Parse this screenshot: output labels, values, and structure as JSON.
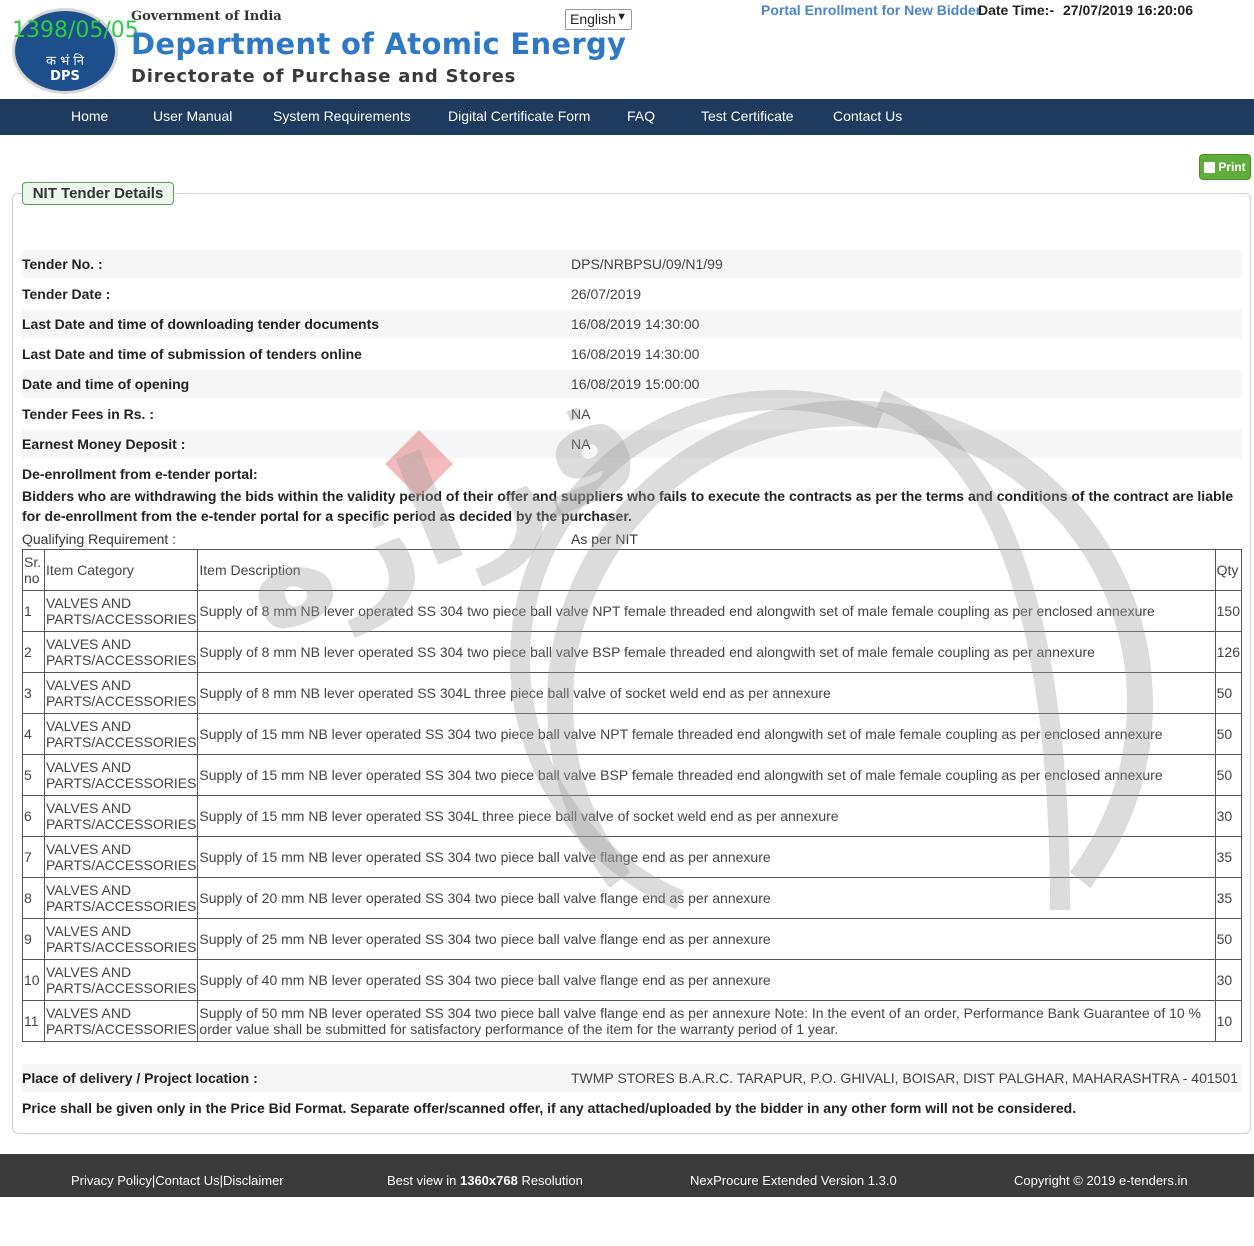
{
  "header": {
    "stamp_text": "1398/05/05",
    "logo_hindi": "क भं नि",
    "logo_abbr": "DPS",
    "gov_label": "Government of India",
    "department": "Department of Atomic Energy",
    "directorate": "Directorate of Purchase and Stores",
    "language": "English",
    "portal_link": "Portal Enrollment for New Bidder",
    "datetime_label": "Date Time:-",
    "datetime_value": "27/07/2019 16:20:06"
  },
  "nav": {
    "items": [
      "Home",
      "User Manual",
      "System Requirements",
      "Digital Certificate Form",
      "FAQ",
      "Test Certificate",
      "Contact Us"
    ]
  },
  "print_label": "Print",
  "section_title": "NIT Tender Details",
  "details": [
    {
      "label": "Tender No. :",
      "value": "DPS/NRBPSU/09/N1/99"
    },
    {
      "label": "Tender Date :",
      "value": "26/07/2019"
    },
    {
      "label": "Last Date and time of downloading tender documents",
      "value": "16/08/2019 14:30:00"
    },
    {
      "label": "Last Date and time of submission of tenders online",
      "value": "16/08/2019 14:30:00"
    },
    {
      "label": "Date and time of opening",
      "value": "16/08/2019 15:00:00"
    },
    {
      "label": "Tender Fees in Rs. :",
      "value": "NA"
    },
    {
      "label": "Earnest Money Deposit :",
      "value": "NA"
    }
  ],
  "deenrollment": {
    "title": "De-enrollment from e-tender portal:",
    "text": "Bidders who are withdrawing the bids within the validity period of their offer and suppliers who fails to execute the contracts as per the terms and conditions of the contract are liable for de-enrollment from the e-tender portal for a specific period as decided by the purchaser."
  },
  "qualifying": {
    "label": "Qualifying Requirement :",
    "value": "As per NIT"
  },
  "items_table": {
    "headers": {
      "sr": "Sr. no",
      "category": "Item Category",
      "description": "Item Description",
      "qty": "Qty"
    },
    "rows": [
      {
        "sr": "1",
        "category": "VALVES AND PARTS/ACCESSORIES",
        "description": "Supply of 8 mm NB lever operated SS 304 two piece ball valve NPT female threaded end alongwith set of male female coupling as per enclosed annexure",
        "qty": "150"
      },
      {
        "sr": "2",
        "category": "VALVES AND PARTS/ACCESSORIES",
        "description": "Supply of 8 mm NB lever operated SS 304 two piece ball valve BSP female threaded end alongwith set of male female coupling as per annexure",
        "qty": "126"
      },
      {
        "sr": "3",
        "category": "VALVES AND PARTS/ACCESSORIES",
        "description": "Supply of 8 mm NB lever operated SS 304L three piece ball valve of socket weld end as per annexure",
        "qty": "50"
      },
      {
        "sr": "4",
        "category": "VALVES AND PARTS/ACCESSORIES",
        "description": "Supply of 15 mm NB lever operated SS 304 two piece ball valve NPT female threaded end alongwith set of male female coupling as per enclosed annexure",
        "qty": "50"
      },
      {
        "sr": "5",
        "category": "VALVES AND PARTS/ACCESSORIES",
        "description": "Supply of 15 mm NB lever operated SS 304 two piece ball valve BSP female threaded end alongwith set of male female coupling as per enclosed annexure",
        "qty": "50"
      },
      {
        "sr": "6",
        "category": "VALVES AND PARTS/ACCESSORIES",
        "description": "Supply of 15 mm NB lever operated SS 304L three piece ball valve of socket weld end as per annexure",
        "qty": "30"
      },
      {
        "sr": "7",
        "category": "VALVES AND PARTS/ACCESSORIES",
        "description": "Supply of 15 mm NB lever operated SS 304 two piece ball valve flange end as per annexure",
        "qty": "35"
      },
      {
        "sr": "8",
        "category": "VALVES AND PARTS/ACCESSORIES",
        "description": "Supply of 20 mm NB lever operated SS 304 two piece ball valve flange end as per annexure",
        "qty": "35"
      },
      {
        "sr": "9",
        "category": "VALVES AND PARTS/ACCESSORIES",
        "description": "Supply of 25 mm NB lever operated SS 304 two piece ball valve flange end as per annexure",
        "qty": "50"
      },
      {
        "sr": "10",
        "category": "VALVES AND PARTS/ACCESSORIES",
        "description": "Supply of 40 mm NB lever operated SS 304 two piece ball valve flange end as per annexure",
        "qty": "30"
      },
      {
        "sr": "11",
        "category": "VALVES AND PARTS/ACCESSORIES",
        "description": "Supply of 50 mm NB lever operated SS 304 two piece ball valve flange end as per annexure Note: In the event of an order, Performance Bank Guarantee of 10 % order value shall be submitted for satisfactory performance of the item for the warranty period of 1 year.",
        "qty": "10"
      }
    ]
  },
  "place": {
    "label": "Place of delivery / Project location :",
    "value": "TWMP STORES B.A.R.C. TARAPUR, P.O. GHIVALI, BOISAR, DIST PALGHAR, MAHARASHTRA - 401501"
  },
  "price_note": "Price shall be given only in the Price Bid Format. Separate offer/scanned offer, if any attached/uploaded by the bidder in any other form will not be considered.",
  "footer": {
    "links": "Privacy Policy|Contact Us|Disclaimer",
    "best_view_prefix": "Best view in ",
    "best_view_res": "1360x768",
    "best_view_suffix": " Resolution",
    "version": "NexProcure Extended Version 1.3.0",
    "copyright": "Copyright © 2019 e-tenders.in"
  }
}
